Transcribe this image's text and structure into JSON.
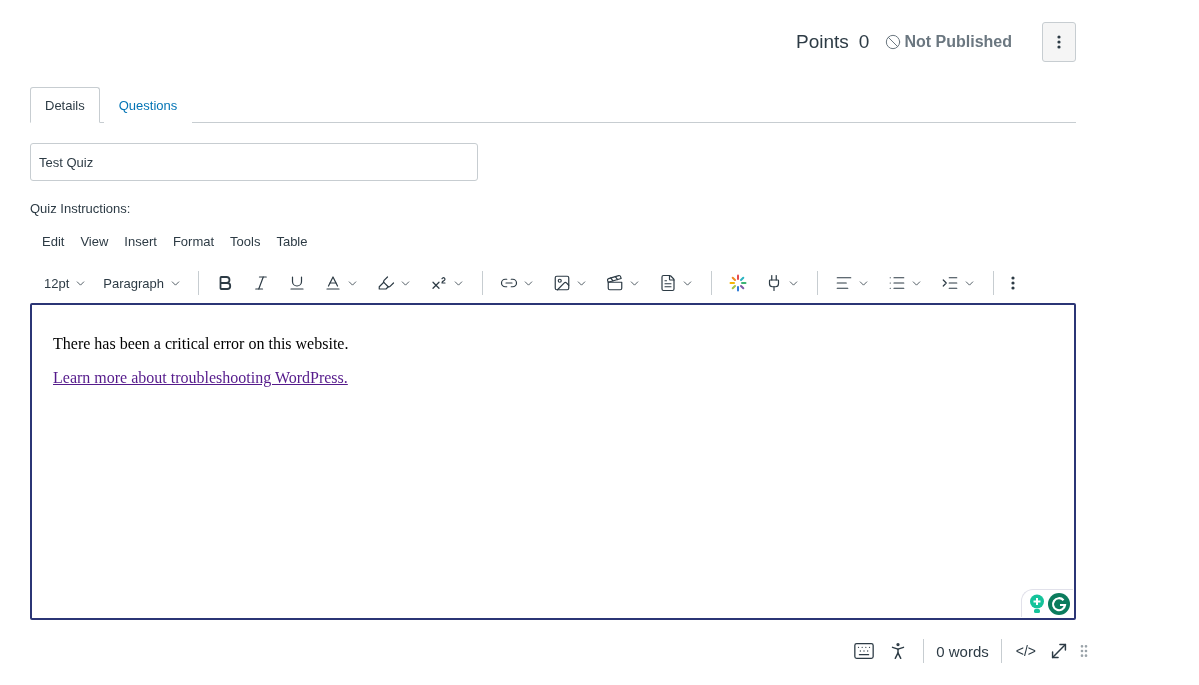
{
  "header": {
    "points_label": "Points",
    "points_value": "0",
    "status": "Not Published"
  },
  "tabs": [
    {
      "label": "Details",
      "selected": true
    },
    {
      "label": "Questions",
      "selected": false
    }
  ],
  "title_field": {
    "value": "Test Quiz"
  },
  "instructions_label": "Quiz Instructions:",
  "menubar": [
    "Edit",
    "View",
    "Insert",
    "Format",
    "Tools",
    "Table"
  ],
  "toolbar": {
    "font_size": "12pt",
    "block_format": "Paragraph"
  },
  "editor": {
    "paragraph": "There has been a critical error on this website.",
    "link": "Learn more about troubleshooting WordPress."
  },
  "status_bar": {
    "word_count": "0 words",
    "html_toggle": "</>"
  }
}
